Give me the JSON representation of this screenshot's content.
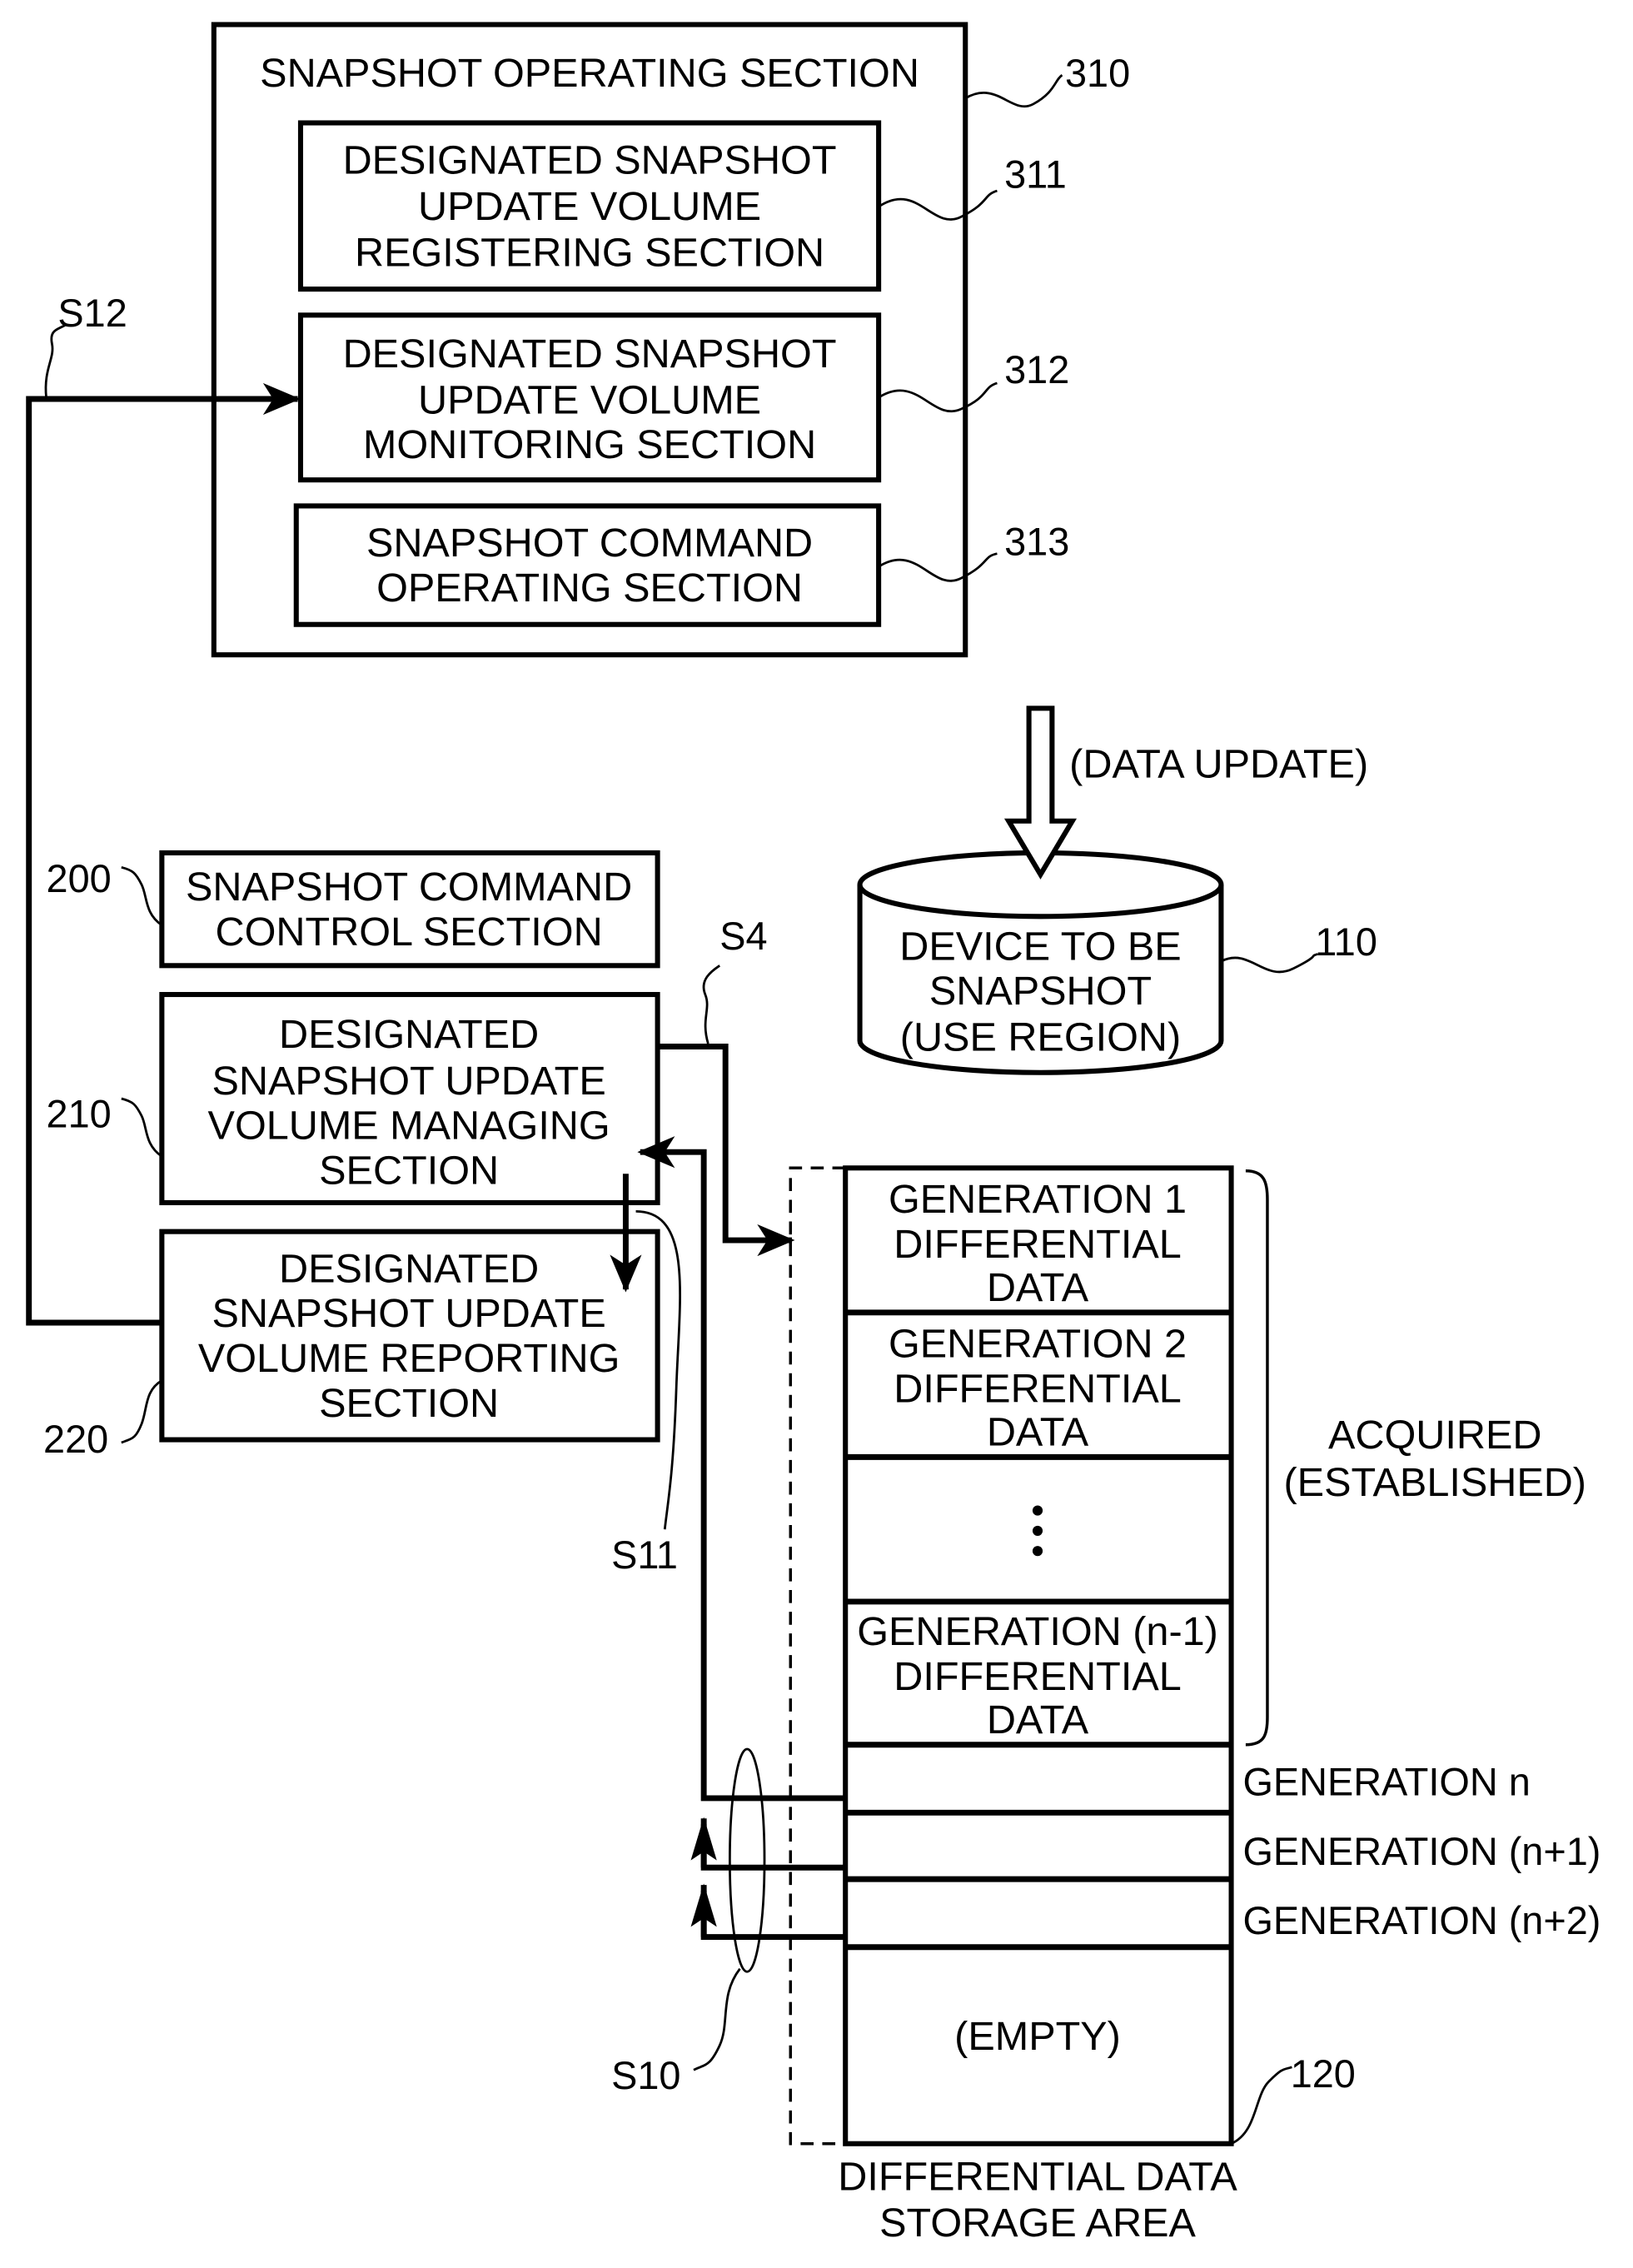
{
  "figure": {
    "snapshot_operating_section": {
      "title": "SNAPSHOT OPERATING SECTION",
      "ref": "310",
      "subsections": [
        {
          "ref": "311",
          "lines": [
            "DESIGNATED SNAPSHOT",
            "UPDATE VOLUME",
            "REGISTERING SECTION"
          ]
        },
        {
          "ref": "312",
          "lines": [
            "DESIGNATED SNAPSHOT",
            "UPDATE VOLUME",
            "MONITORING SECTION"
          ]
        },
        {
          "ref": "313",
          "lines": [
            "SNAPSHOT COMMAND",
            "OPERATING SECTION"
          ]
        }
      ]
    },
    "command_control": {
      "ref": "200",
      "lines": [
        "SNAPSHOT COMMAND",
        "CONTROL SECTION"
      ]
    },
    "managing": {
      "ref": "210",
      "lines": [
        "DESIGNATED",
        "SNAPSHOT UPDATE",
        "VOLUME MANAGING",
        "SECTION"
      ]
    },
    "reporting": {
      "ref": "220",
      "lines": [
        "DESIGNATED",
        "SNAPSHOT UPDATE",
        "VOLUME REPORTING",
        "SECTION"
      ]
    },
    "device": {
      "ref": "110",
      "lines": [
        "DEVICE TO BE",
        "SNAPSHOT",
        "(USE REGION)"
      ],
      "data_update_label": "(DATA UPDATE)"
    },
    "storage": {
      "ref": "120",
      "caption_lines": [
        "DIFFERENTIAL DATA",
        "STORAGE AREA"
      ],
      "acquired_lines": [
        "ACQUIRED",
        "(ESTABLISHED)"
      ],
      "rows": [
        {
          "lines": [
            "GENERATION 1",
            "DIFFERENTIAL",
            "DATA"
          ]
        },
        {
          "lines": [
            "GENERATION 2",
            "DIFFERENTIAL",
            "DATA"
          ]
        },
        {
          "lines": [
            "⋮"
          ]
        },
        {
          "lines": [
            "GENERATION (n-1)",
            "DIFFERENTIAL",
            "DATA"
          ]
        },
        {
          "lines": [],
          "side_label": "GENERATION n"
        },
        {
          "lines": [],
          "side_label": "GENERATION (n+1)"
        },
        {
          "lines": [],
          "side_label": "GENERATION (n+2)"
        },
        {
          "lines": [
            "(EMPTY)"
          ]
        }
      ]
    },
    "signals": {
      "s4": "S4",
      "s10": "S10",
      "s11": "S11",
      "s12": "S12"
    }
  }
}
